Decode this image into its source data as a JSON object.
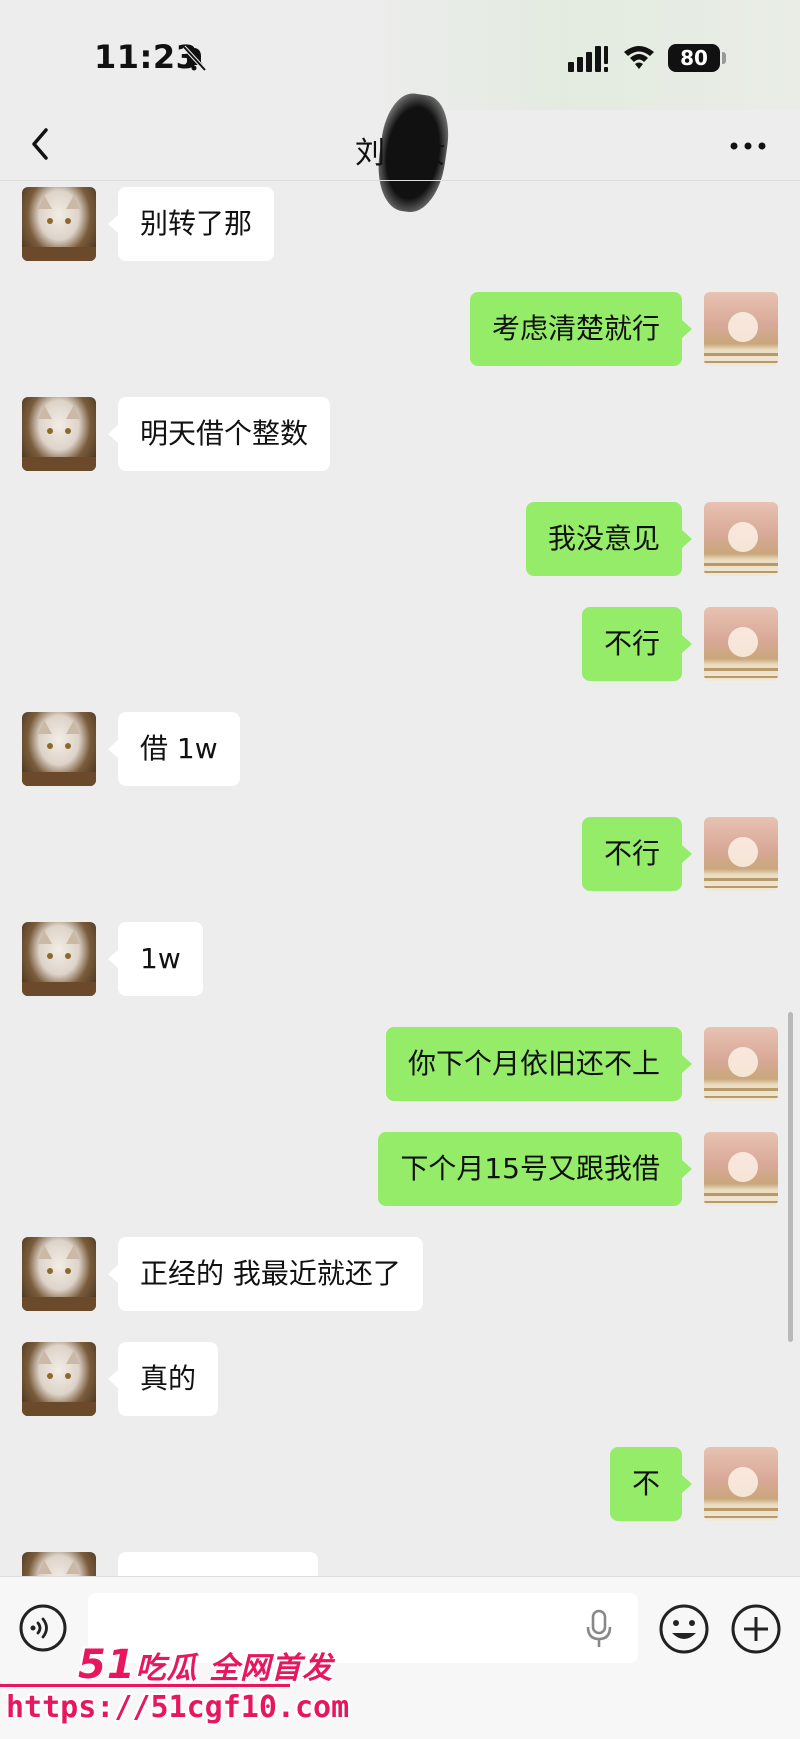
{
  "status_bar": {
    "time": "11:23",
    "battery": "80"
  },
  "header": {
    "title": "刘航汝"
  },
  "messages": [
    {
      "side": "left",
      "text": "别转了那"
    },
    {
      "side": "right",
      "text": "考虑清楚就行"
    },
    {
      "side": "left",
      "text": "明天借个整数"
    },
    {
      "side": "right",
      "text": "我没意见"
    },
    {
      "side": "right",
      "text": "不行"
    },
    {
      "side": "left",
      "text": "借 1w"
    },
    {
      "side": "right",
      "text": "不行"
    },
    {
      "side": "left",
      "text": "1w"
    },
    {
      "side": "right",
      "text": "你下个月依旧还不上"
    },
    {
      "side": "right",
      "text": "下个月15号又跟我借"
    },
    {
      "side": "left",
      "text": "正经的 我最近就还了"
    },
    {
      "side": "left",
      "text": "真的"
    },
    {
      "side": "right",
      "text": "不"
    },
    {
      "side": "left",
      "text": ""
    }
  ],
  "input": {
    "value": ""
  },
  "watermark": {
    "brand_num": "51",
    "brand_text": "吃瓜 全网首发",
    "url": "https://51cgf10.com"
  },
  "colors": {
    "background": "#ededed",
    "my_bubble": "#95ec69",
    "their_bubble": "#ffffff",
    "watermark": "#e8175d"
  }
}
